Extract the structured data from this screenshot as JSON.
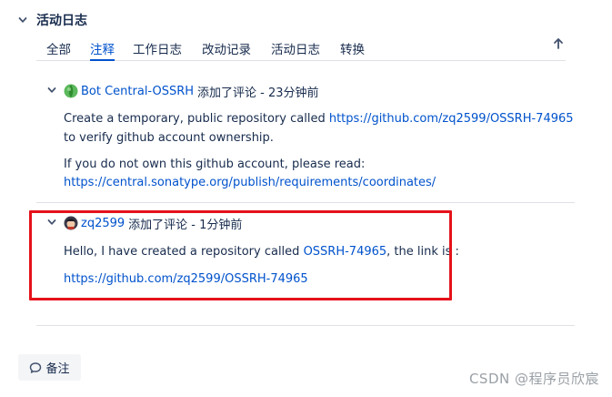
{
  "section": {
    "title": "活动日志"
  },
  "tabs": [
    {
      "label": "全部",
      "active": false
    },
    {
      "label": "注释",
      "active": true
    },
    {
      "label": "工作日志",
      "active": false
    },
    {
      "label": "改动记录",
      "active": false
    },
    {
      "label": "活动日志",
      "active": false
    },
    {
      "label": "转换",
      "active": false
    }
  ],
  "comments": [
    {
      "author": "Bot Central-OSSRH",
      "action": "添加了评论 - 23分钟前",
      "line1_prefix": "Create a temporary, public repository called ",
      "line1_link": "https://github.com/zq2599/OSSRH-74965",
      "line2": "to verify github account ownership.",
      "line3": "If you do not own this github account, please read:",
      "line4_link": "https://central.sonatype.org/publish/requirements/coordinates/"
    },
    {
      "author": "zq2599",
      "action": "添加了评论 - 1分钟前",
      "line1_prefix": "Hello, I have created a repository called ",
      "line1_link": "OSSRH-74965",
      "line1_suffix": ", the link is :",
      "line2_link": "https://github.com/zq2599/OSSRH-74965"
    }
  ],
  "note_button": {
    "label": "备注"
  },
  "watermark": "CSDN @程序员欣宸",
  "colors": {
    "link": "#0052cc",
    "highlight": "#e5121b",
    "text": "#172b4d"
  }
}
